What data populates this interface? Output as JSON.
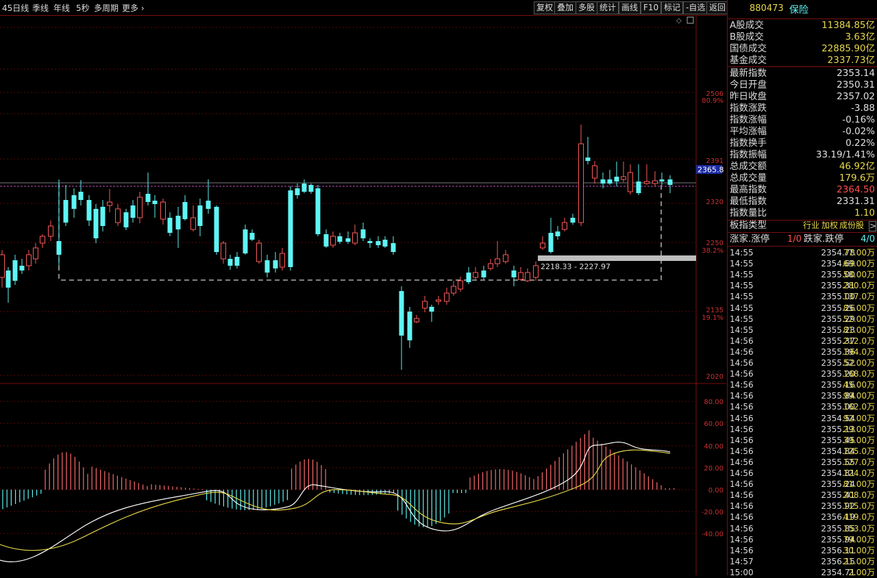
{
  "toolbar": {
    "periods": [
      "45日线",
      "季线",
      "年线",
      "5秒",
      "多周期",
      "更多"
    ],
    "buttons": [
      "复权",
      "叠加",
      "多股",
      "统计",
      "画线",
      "F10",
      "标记",
      "-自选",
      "返回"
    ]
  },
  "panel": {
    "code": "880473",
    "name": "保险",
    "turnover": [
      {
        "label": "A股成交",
        "value": "11384.85亿"
      },
      {
        "label": "B股成交",
        "value": "3.63亿"
      },
      {
        "label": "国债成交",
        "value": "22885.90亿"
      },
      {
        "label": "基金成交",
        "value": "2337.73亿"
      }
    ],
    "stats": [
      {
        "label": "最新指数",
        "value": "2353.14",
        "color": "#e0e0e0"
      },
      {
        "label": "今日开盘",
        "value": "2350.31",
        "color": "#e0e0e0"
      },
      {
        "label": "昨日收盘",
        "value": "2357.02",
        "color": "#e0e0e0"
      },
      {
        "label": "指数涨跌",
        "value": "-3.88",
        "color": "#e0e0e0"
      },
      {
        "label": "指数涨幅",
        "value": "-0.16%",
        "color": "#e0e0e0"
      },
      {
        "label": "平均涨幅",
        "value": "-0.02%",
        "color": "#e0e0e0"
      },
      {
        "label": "指数换手",
        "value": "0.22%",
        "color": "#e0e0e0"
      },
      {
        "label": "指数振幅",
        "value": "33.19/1.41%",
        "color": "#e0e0e0"
      },
      {
        "label": "总成交额",
        "value": "46.92亿",
        "color": "#e8d84a"
      },
      {
        "label": "总成交量",
        "value": "179.6万",
        "color": "#e8d84a"
      },
      {
        "label": "最高指数",
        "value": "2364.50",
        "color": "#ff5050"
      },
      {
        "label": "最低指数",
        "value": "2331.31",
        "color": "#e0e0e0"
      },
      {
        "label": "指数量比",
        "value": "1.10",
        "color": "#e8d84a"
      }
    ],
    "board_type_label": "板指类型",
    "board_type_values": [
      "行业",
      "加权",
      "成份股"
    ],
    "board_type_arrow": ">",
    "updown": {
      "up_label": "涨家.涨停",
      "up_value": "1/0",
      "down_label": "跌家.跌停",
      "down_value": "4/0"
    },
    "ticks": [
      [
        "14:55",
        "2354.78",
        "77.00万"
      ],
      [
        "14:55",
        "2354.69",
        "69.00万"
      ],
      [
        "14:55",
        "2355.00",
        "58.00万"
      ],
      [
        "14:55",
        "2355.31",
        "280.0万"
      ],
      [
        "14:55",
        "2355.00",
        "137.0万"
      ],
      [
        "14:55",
        "2355.26",
        "85.00万"
      ],
      [
        "14:55",
        "2355.29",
        "52.00万"
      ],
      [
        "14:55",
        "2355.23",
        "81.00万"
      ],
      [
        "14:56",
        "2355.37",
        "212.0万"
      ],
      [
        "14:56",
        "2355.36",
        "194.0万"
      ],
      [
        "14:56",
        "2355.52",
        "52.00万"
      ],
      [
        "14:56",
        "2355.20",
        "168.0万"
      ],
      [
        "14:56",
        "2355.16",
        "45.00万"
      ],
      [
        "14:56",
        "2355.84",
        "99.00万"
      ],
      [
        "14:56",
        "2355.00",
        "162.0万"
      ],
      [
        "14:56",
        "2354.54",
        "92.00万"
      ],
      [
        "14:56",
        "2355.13",
        "29.00万"
      ],
      [
        "14:56",
        "2355.45",
        "39.00万"
      ],
      [
        "14:56",
        "2354.84",
        "125.0万"
      ],
      [
        "14:56",
        "2355.55",
        "127.0万"
      ],
      [
        "14:56",
        "2354.81",
        "124.0万"
      ],
      [
        "14:56",
        "2355.24",
        "81.00万"
      ],
      [
        "14:56",
        "2355.41",
        "208.0万"
      ],
      [
        "14:56",
        "2355.92",
        "115.0万"
      ],
      [
        "14:56",
        "2356.19",
        "419.0万"
      ],
      [
        "14:56",
        "2355.85",
        "153.0万"
      ],
      [
        "14:56",
        "2355.94",
        "79.00万"
      ],
      [
        "14:56",
        "2356.11",
        "30.00万"
      ],
      [
        "14:57",
        "2356.15",
        "21.00万"
      ],
      [
        "15:00",
        "2354.71",
        "2.00万"
      ]
    ]
  },
  "chart_data": {
    "type": "candlestick",
    "price_axis_ticks": [
      "2506",
      "80.9%",
      "2391",
      "2320",
      "2250",
      "38.2%",
      "2135",
      "19.1%",
      "2020"
    ],
    "indicator_axis_ticks": [
      "80.00",
      "60.00",
      "40.00",
      "20.00",
      "0.00",
      "-20.00",
      "-40.00"
    ],
    "current_price_label": "2365.8",
    "box_range_label": "2218.33 - 2227.97",
    "colors": {
      "up": "#ff5a5a",
      "down": "#5ff5f5",
      "grid": "#5a0a0a",
      "box": "#cfcfcf",
      "dif": "#ffffff",
      "dea": "#e8d84a"
    }
  }
}
